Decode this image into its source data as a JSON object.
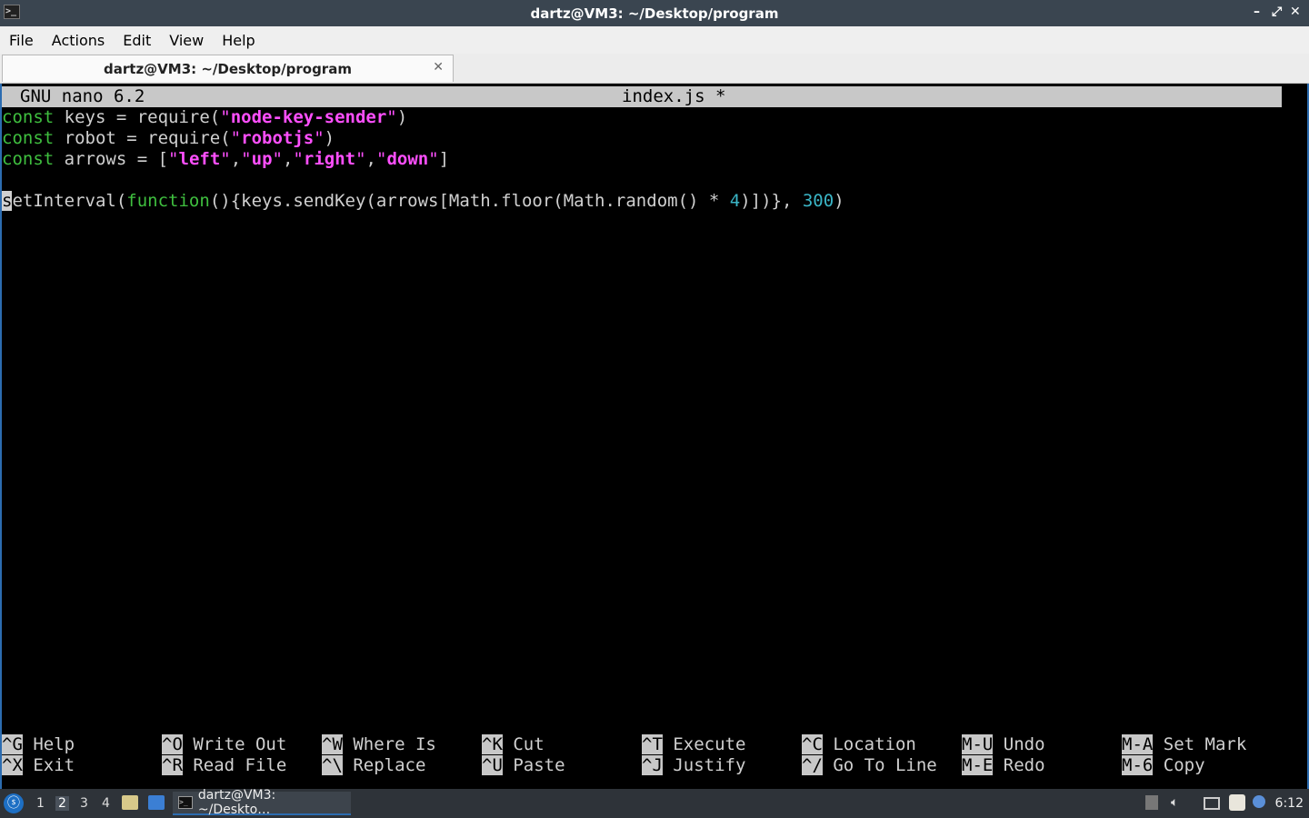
{
  "window": {
    "title": "dartz@VM3: ~/Desktop/program",
    "controls": [
      "–",
      "⤢",
      "✕"
    ]
  },
  "menubar": {
    "items": [
      "File",
      "Actions",
      "Edit",
      "View",
      "Help"
    ]
  },
  "tab": {
    "label": "dartz@VM3: ~/Desktop/program",
    "close": "✕"
  },
  "nano": {
    "version": "GNU nano 6.2",
    "filename": "index.js *",
    "code": {
      "line1": {
        "kw": "const",
        "rest": " keys = require(",
        "q1": "\"",
        "str": "node-key-sender",
        "q2": "\"",
        "end": ")"
      },
      "line2": {
        "kw": "const",
        "rest": " robot = require(",
        "q1": "\"",
        "str": "robotjs",
        "q2": "\"",
        "end": ")"
      },
      "line3": {
        "kw": "const",
        "rest": " arrows = [",
        "items": [
          "left",
          "up",
          "right",
          "down"
        ],
        "end": "]"
      },
      "line5": {
        "cursor": "s",
        "a": "etInterval(",
        "kw": "function",
        "b": "(){keys.sendKey(arrows[Math.floor(Math.random() * ",
        "n1": "4",
        "c": ")])}, ",
        "n2": "300",
        "d": ")"
      }
    },
    "shortcuts": [
      {
        "key": "^G",
        "label": "Help"
      },
      {
        "key": "^X",
        "label": "Exit"
      },
      {
        "key": "^O",
        "label": "Write Out"
      },
      {
        "key": "^R",
        "label": "Read File"
      },
      {
        "key": "^W",
        "label": "Where Is"
      },
      {
        "key": "^\\",
        "label": "Replace"
      },
      {
        "key": "^K",
        "label": "Cut"
      },
      {
        "key": "^U",
        "label": "Paste"
      },
      {
        "key": "^T",
        "label": "Execute"
      },
      {
        "key": "^J",
        "label": "Justify"
      },
      {
        "key": "^C",
        "label": "Location"
      },
      {
        "key": "^/",
        "label": "Go To Line"
      },
      {
        "key": "M-U",
        "label": "Undo"
      },
      {
        "key": "M-E",
        "label": "Redo"
      },
      {
        "key": "M-A",
        "label": "Set Mark"
      },
      {
        "key": "M-6",
        "label": "Copy"
      }
    ]
  },
  "taskbar": {
    "workspaces": [
      "1",
      "2",
      "3",
      "4"
    ],
    "active_workspace": "2",
    "task_label": "dartz@VM3: ~/Deskto…",
    "clock": "6:12"
  },
  "colors": {
    "keyword": "#3fbf3f",
    "string": "#ff4fff",
    "number": "#3ab5c6",
    "accent": "#2c6cb0"
  }
}
